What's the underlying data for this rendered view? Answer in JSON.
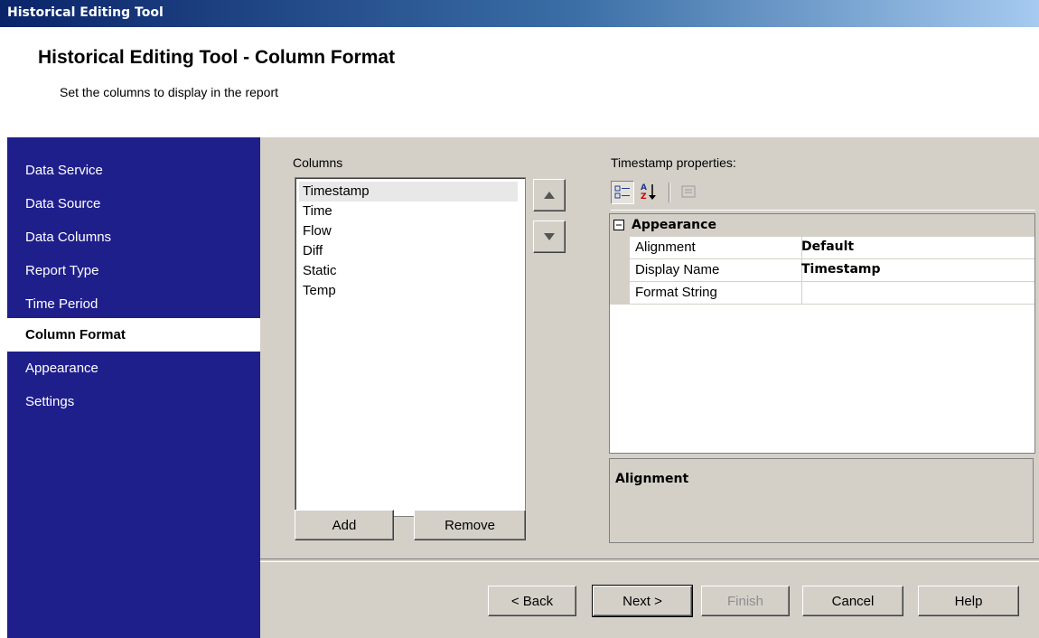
{
  "window": {
    "title": "Historical Editing Tool"
  },
  "header": {
    "title": "Historical Editing Tool - Column Format",
    "subtitle": "Set the columns to display in the report"
  },
  "sidebar": {
    "items": [
      {
        "label": "Data Service"
      },
      {
        "label": "Data Source"
      },
      {
        "label": "Data Columns"
      },
      {
        "label": "Report Type"
      },
      {
        "label": "Time Period"
      },
      {
        "label": "Column Format",
        "active": true
      },
      {
        "label": "Appearance"
      },
      {
        "label": "Settings"
      }
    ]
  },
  "columns": {
    "label": "Columns",
    "items": [
      "Timestamp",
      "Time",
      "Flow",
      "Diff",
      "Static",
      "Temp"
    ],
    "selected": "Timestamp",
    "add_label": "Add",
    "remove_label": "Remove",
    "up_icon": "arrow-up-icon",
    "down_icon": "arrow-down-icon"
  },
  "properties": {
    "label": "Timestamp properties:",
    "toolbar": [
      "categorized-icon",
      "alphabetical-icon",
      "property-pages-icon"
    ],
    "category": "Appearance",
    "rows": [
      {
        "name": "Alignment",
        "value": "Default"
      },
      {
        "name": "Display Name",
        "value": "Timestamp"
      },
      {
        "name": "Format String",
        "value": ""
      }
    ],
    "description_title": "Alignment"
  },
  "footer": {
    "back_label": "< Back",
    "next_label": "Next >",
    "finish_label": "Finish",
    "cancel_label": "Cancel",
    "help_label": "Help"
  },
  "colors": {
    "sidebar_bg": "#1f1f8c",
    "dialog_bg": "#d4d0c8",
    "titlebar_start": "#0a246a",
    "titlebar_end": "#a6caf0"
  }
}
